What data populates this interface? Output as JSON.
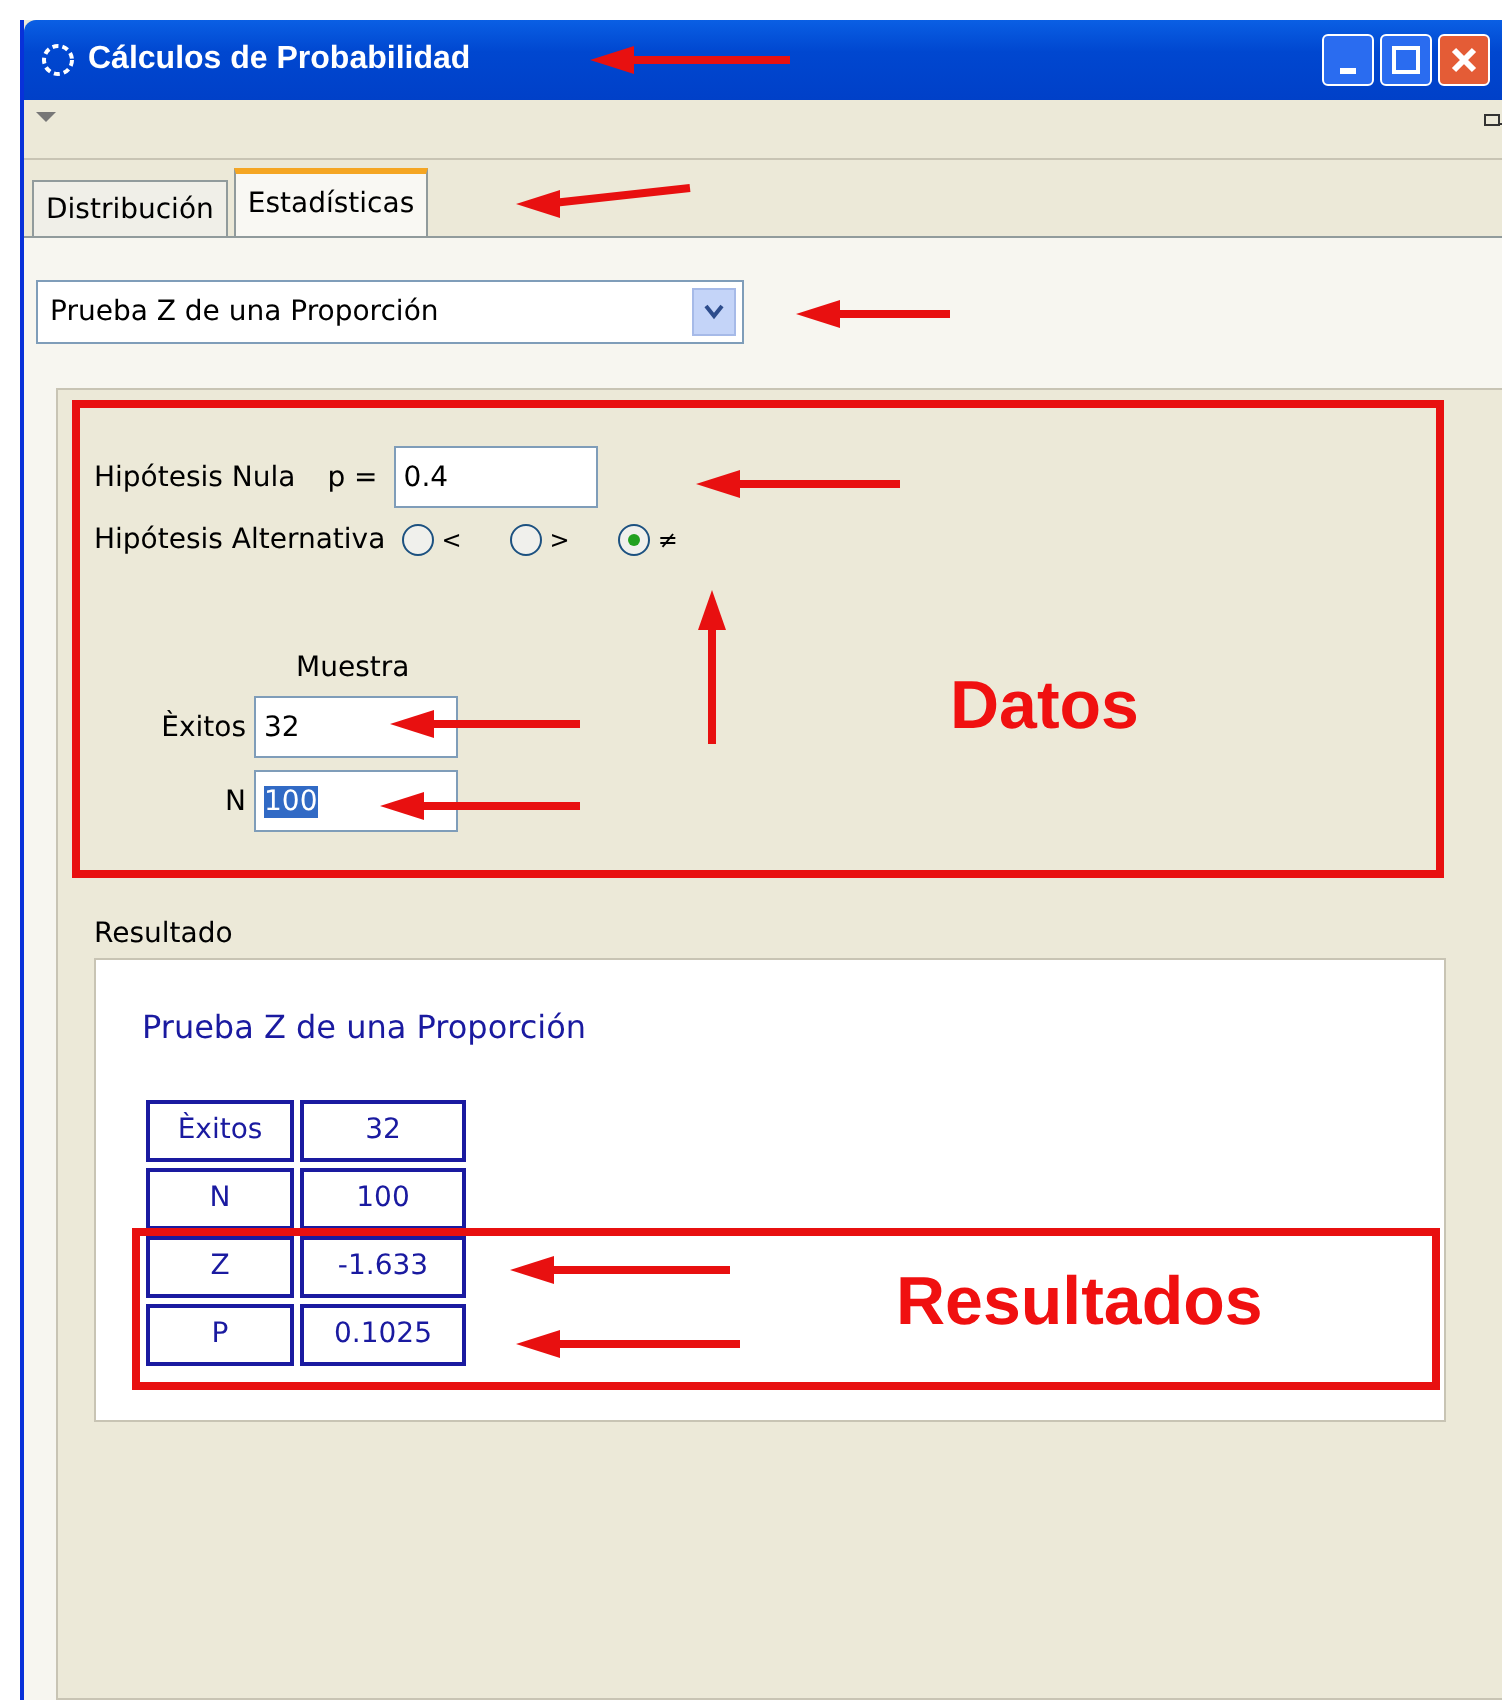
{
  "window": {
    "title": "Cálculos de Probabilidad"
  },
  "tabs": [
    {
      "label": "Distribución",
      "selected": false
    },
    {
      "label": "Estadísticas",
      "selected": true
    }
  ],
  "procedure": {
    "value": "Prueba Z de una Proporción"
  },
  "null_hypothesis": {
    "label": "Hipótesis Nula",
    "param": "p =",
    "value": "0.4"
  },
  "alternative": {
    "label": "Hipótesis Alternativa",
    "options": [
      {
        "label": "<",
        "selected": false
      },
      {
        "label": ">",
        "selected": false
      },
      {
        "label": "≠",
        "selected": true
      }
    ]
  },
  "sample": {
    "heading": "Muestra",
    "fields": [
      {
        "label": "Èxitos",
        "value": "32",
        "selected": false
      },
      {
        "label": "N",
        "value": "100",
        "selected": true
      }
    ]
  },
  "result": {
    "label": "Resultado",
    "title": "Prueba Z de una Proporción",
    "rows": [
      {
        "name": "Èxitos",
        "value": "32"
      },
      {
        "name": "N",
        "value": "100"
      },
      {
        "name": "Z",
        "value": "-1.633"
      },
      {
        "name": "P",
        "value": "0.1025"
      }
    ]
  },
  "annotations": [
    {
      "label": "Datos"
    },
    {
      "label": "Resultados"
    }
  ]
}
